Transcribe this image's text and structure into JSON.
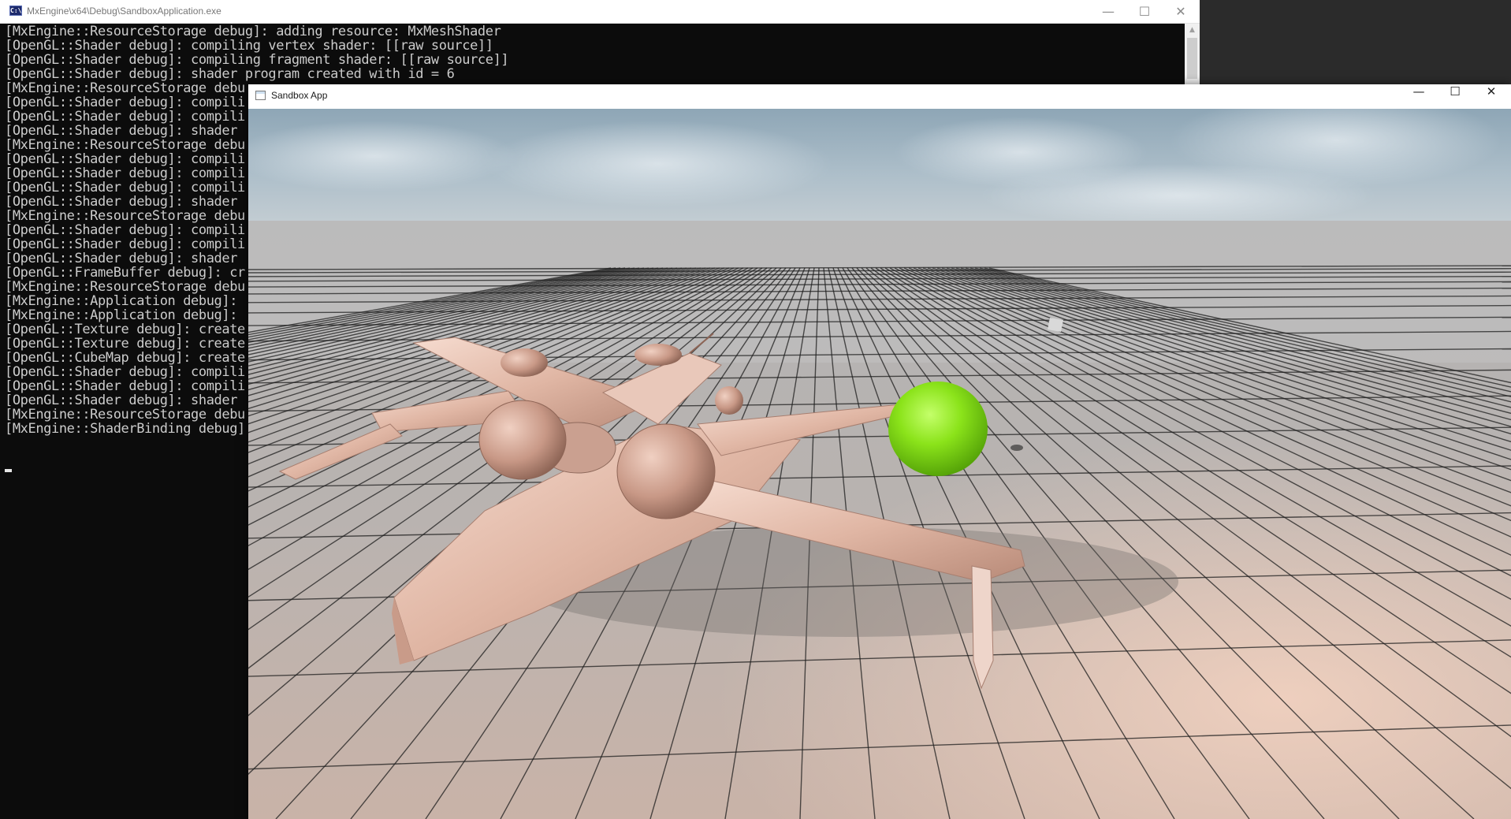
{
  "console": {
    "title": "MxEngine\\x64\\Debug\\SandboxApplication.exe",
    "lines": [
      "[MxEngine::ResourceStorage debug]: adding resource: MxMeshShader",
      "[OpenGL::Shader debug]: compiling vertex shader: [[raw source]]",
      "[OpenGL::Shader debug]: compiling fragment shader: [[raw source]]",
      "[OpenGL::Shader debug]: shader program created with id = 6",
      "[MxEngine::ResourceStorage debu",
      "[OpenGL::Shader debug]: compili",
      "[OpenGL::Shader debug]: compili",
      "[OpenGL::Shader debug]: shader ",
      "[MxEngine::ResourceStorage debu",
      "[OpenGL::Shader debug]: compili",
      "[OpenGL::Shader debug]: compili",
      "[OpenGL::Shader debug]: compili",
      "[OpenGL::Shader debug]: shader ",
      "[MxEngine::ResourceStorage debu",
      "[OpenGL::Shader debug]: compili",
      "[OpenGL::Shader debug]: compili",
      "[OpenGL::Shader debug]: shader ",
      "[OpenGL::FrameBuffer debug]: cr",
      "[MxEngine::ResourceStorage debu",
      "[MxEngine::Application debug]: ",
      "[MxEngine::Application debug]: ",
      "[OpenGL::Texture debug]: create",
      "[OpenGL::Texture debug]: create",
      "[OpenGL::CubeMap debug]: create",
      "[OpenGL::Shader debug]: compili",
      "[OpenGL::Shader debug]: compili",
      "[OpenGL::Shader debug]: shader ",
      "[MxEngine::ResourceStorage debu",
      "[MxEngine::ShaderBinding debug]"
    ],
    "controls": {
      "minimize": "—",
      "maximize": "☐",
      "close": "✕"
    }
  },
  "sandbox": {
    "title": "Sandbox App",
    "controls": {
      "minimize": "—",
      "maximize": "☐",
      "close": "✕"
    }
  },
  "scene": {
    "objects": [
      "sky-cubemap",
      "grid-floor",
      "spaceship-model",
      "green-sphere",
      "small-cube"
    ],
    "colors": {
      "sphere": "#86e40f",
      "ship": "#e8c2b2",
      "grid_lines": "#1a1a1a",
      "floor": "#b8b2ae"
    }
  }
}
